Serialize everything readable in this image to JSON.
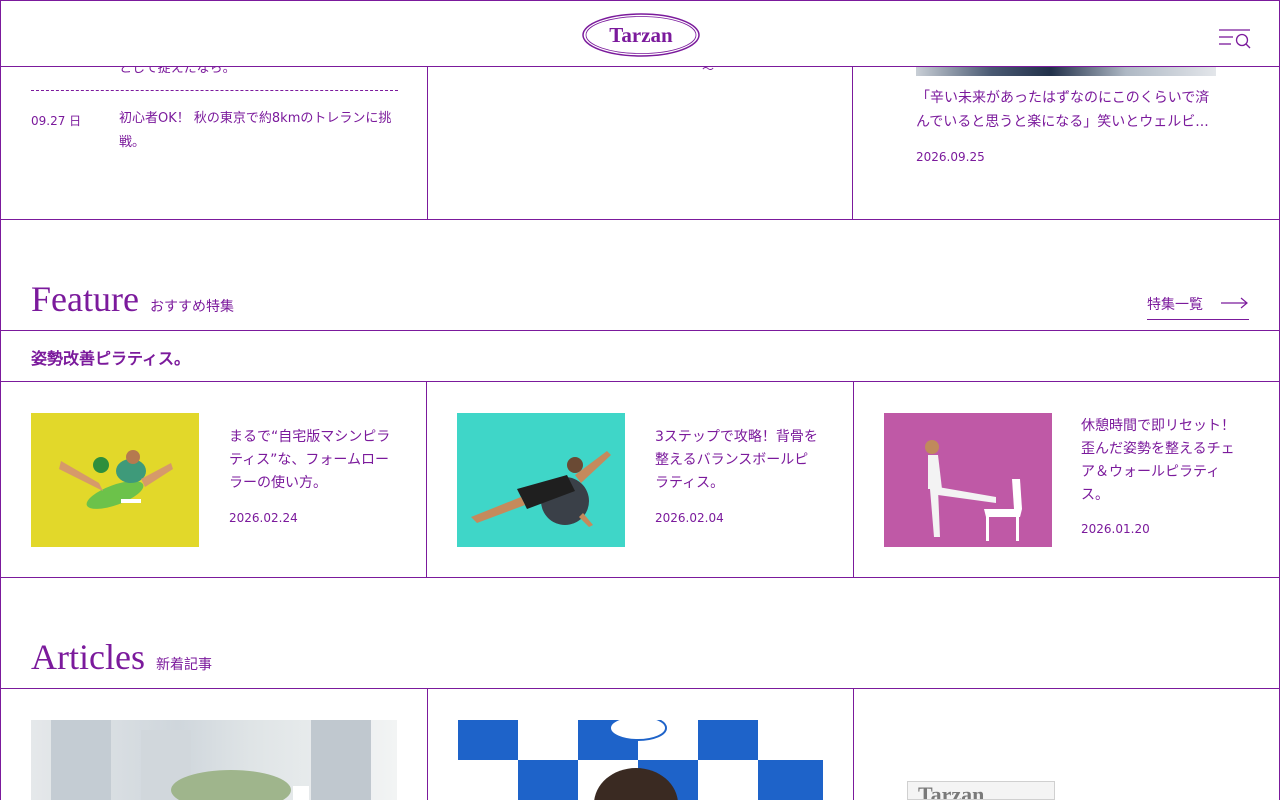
{
  "header": {
    "logo_text": "Tarzan",
    "menu_icon": "menu-search-icon"
  },
  "top_row": {
    "news": [
      {
        "date": "",
        "title": "として捉えたなら。"
      },
      {
        "date": "09.27 日",
        "title_line1": "初心者OK！ 秋の東京で約8kmのトレランに挑",
        "title_line2": "戦。"
      }
    ],
    "middle_fragment": "〜",
    "right_card": {
      "title_line1": "「辛い未来があったはずなのにこのくらいで済",
      "title_line2": "んでいると思うと楽になる」笑いとウェルビ...",
      "date": "2026.09.25"
    }
  },
  "feature": {
    "heading": "Feature",
    "subheading": "おすすめ特集",
    "more_label": "特集一覧",
    "more_icon": "long-arrow-right-icon",
    "feature_name": "姿勢改善ピラティス。",
    "cards": [
      {
        "title_lines": [
          "まるで“自宅版マシンピラ",
          "ティス”な、フォームロー",
          "ラーの使い方。"
        ],
        "date": "2026.02.24",
        "bg": "#e2d82a"
      },
      {
        "title_lines": [
          "3ステップで攻略！背骨を",
          "整えるバランスボールピ",
          "ラティス。"
        ],
        "date": "2026.02.04",
        "bg": "#3fd6c8"
      },
      {
        "title_lines": [
          "休憩時間で即リセット！",
          "歪んだ姿勢を整えるチェ",
          "ア＆ウォールピラティ",
          "ス。"
        ],
        "date": "2026.01.20",
        "bg": "#bf59a6"
      }
    ]
  },
  "articles": {
    "heading": "Articles",
    "subheading": "新着記事",
    "magazine_logo": "Tarzan"
  },
  "colors": {
    "accent": "#7b1a9c"
  }
}
